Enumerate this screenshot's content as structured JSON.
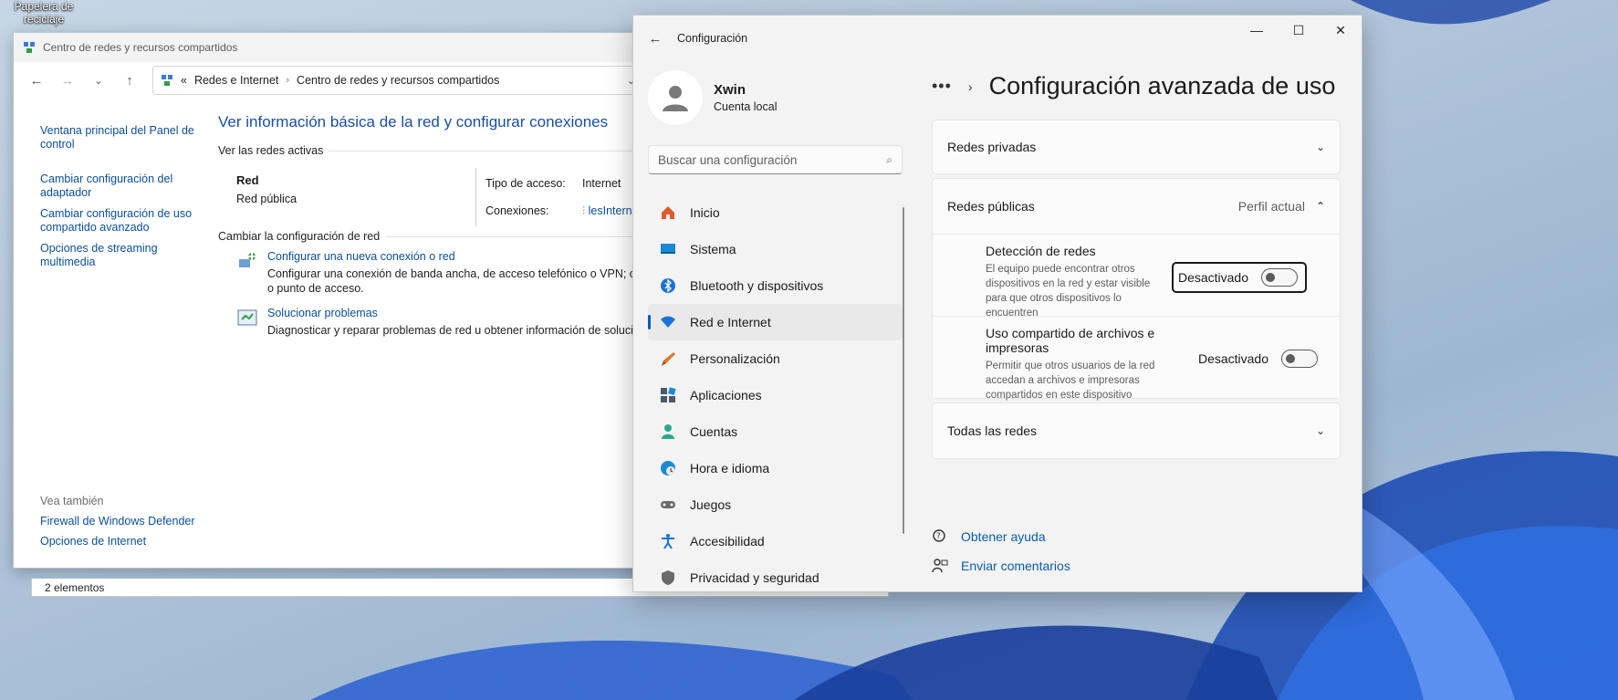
{
  "desktop": {
    "recycle_bin": "Papelera de reciclaje"
  },
  "control_panel": {
    "title": "Centro de redes y recursos compartidos",
    "address": {
      "overflow": "«",
      "crumb1": "Redes e Internet",
      "crumb2": "Centro de redes y recursos compartidos"
    },
    "sidebar": [
      "Ventana principal del Panel de control",
      "Cambiar configuración del adaptador",
      "Cambiar configuración de uso compartido avanzado",
      "Opciones de streaming multimedia"
    ],
    "see_also": {
      "heading": "Vea también",
      "items": [
        "Firewall de Windows Defender",
        "Opciones de Internet"
      ]
    },
    "heading": "Ver información básica de la red y configurar conexiones",
    "active_networks": "Ver las redes activas",
    "network": {
      "name": "Red",
      "type": "Red pública",
      "access_label": "Tipo de acceso:",
      "access_value": "Internet",
      "connections_label": "Conexiones:",
      "connections_value": "lesInternet"
    },
    "change_heading": "Cambiar la configuración de red",
    "tasks": [
      {
        "title": "Configurar una nueva conexión o red",
        "desc": "Configurar una conexión de banda ancha, de acceso telefónico o VPN; o bien configurar un enrutador o punto de acceso."
      },
      {
        "title": "Solucionar problemas",
        "desc": "Diagnosticar y reparar problemas de red u obtener información de solución de problemas."
      }
    ],
    "status": "2 elementos"
  },
  "settings": {
    "title": "Configuración",
    "user": {
      "name": "Xwin",
      "type": "Cuenta local"
    },
    "search_placeholder": "Buscar una configuración",
    "menu": [
      {
        "label": "Inicio",
        "icon": "home-icon",
        "color": "#e05a2b"
      },
      {
        "label": "Sistema",
        "icon": "system-icon",
        "color": "#1a8ad4"
      },
      {
        "label": "Bluetooth y dispositivos",
        "icon": "bluetooth-icon",
        "color": "#1a73d4"
      },
      {
        "label": "Red e Internet",
        "icon": "wifi-icon",
        "color": "#1a73d4"
      },
      {
        "label": "Personalización",
        "icon": "brush-icon",
        "color": "#e0782b"
      },
      {
        "label": "Aplicaciones",
        "icon": "apps-icon",
        "color": "#4a5a6a"
      },
      {
        "label": "Cuentas",
        "icon": "accounts-icon",
        "color": "#2aa88a"
      },
      {
        "label": "Hora e idioma",
        "icon": "globe-icon",
        "color": "#1a8ad4"
      },
      {
        "label": "Juegos",
        "icon": "gamepad-icon",
        "color": "#6a6a6a"
      },
      {
        "label": "Accesibilidad",
        "icon": "accessibility-icon",
        "color": "#1a73d4"
      },
      {
        "label": "Privacidad y seguridad",
        "icon": "shield-icon",
        "color": "#6a6a6a"
      }
    ],
    "breadcrumb_dots": "•••",
    "page_title": "Configuración avanzada de uso compartido",
    "private_networks": "Redes privadas",
    "public_networks": "Redes públicas",
    "current_profile": "Perfil actual",
    "discovery": {
      "title": "Detección de redes",
      "desc": "El equipo puede encontrar otros dispositivos en la red y estar visible para que otros dispositivos lo encuentren",
      "state": "Desactivado"
    },
    "sharing": {
      "title": "Uso compartido de archivos e impresoras",
      "desc": "Permitir que otros usuarios de la red accedan a archivos e impresoras compartidos en este dispositivo",
      "state": "Desactivado"
    },
    "all_networks": "Todas las redes",
    "help": "Obtener ayuda",
    "feedback": "Enviar comentarios"
  }
}
